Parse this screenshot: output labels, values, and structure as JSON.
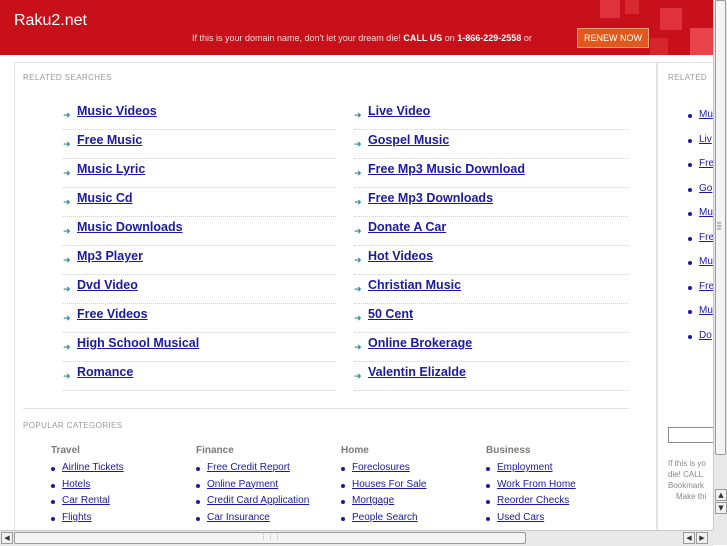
{
  "header": {
    "site_title": "Raku2.net",
    "tagline_prefix": "If this is your domain name, don't let your dream die!",
    "call_us": "CALL US",
    "on": "on",
    "phone": "1-866-229-2558",
    "or": "or",
    "renew_label": "RENEW NOW",
    "bg_color": "#c8101a"
  },
  "related_searches": {
    "label": "RELATED SEARCHES",
    "left": [
      "Music Videos",
      "Free Music",
      "Music Lyric",
      "Music Cd",
      "Music Downloads",
      "Mp3 Player",
      "Dvd Video",
      "Free Videos",
      "High School Musical",
      "Romance"
    ],
    "right": [
      "Live Video",
      "Gospel Music",
      "Free Mp3 Music Download",
      "Free Mp3 Downloads",
      "Donate A Car",
      "Hot Videos",
      "Christian Music",
      "50 Cent",
      "Online Brokerage",
      "Valentin Elizalde"
    ]
  },
  "popular_categories": {
    "label": "POPULAR CATEGORIES",
    "columns": [
      {
        "title": "Travel",
        "links": [
          "Airline Tickets",
          "Hotels",
          "Car Rental",
          "Flights"
        ]
      },
      {
        "title": "Finance",
        "links": [
          "Free Credit Report",
          "Online Payment",
          "Credit Card Application",
          "Car Insurance"
        ]
      },
      {
        "title": "Home",
        "links": [
          "Foreclosures",
          "Houses For Sale",
          "Mortgage",
          "People Search"
        ]
      },
      {
        "title": "Business",
        "links": [
          "Employment",
          "Work From Home",
          "Reorder Checks",
          "Used Cars"
        ]
      }
    ]
  },
  "sidebar": {
    "label": "RELATED",
    "links": [
      "Mu",
      "Liv",
      "Fre",
      "Go",
      "Mu",
      "Fre",
      "Mu",
      "Fre",
      "Mu",
      "Do"
    ],
    "note_lines": [
      "If this is yo",
      "die! CALL",
      "Bookmark",
      "Make thi"
    ]
  },
  "scrollbars": {
    "vertical_icon": "scrollbar-vertical",
    "horizontal_icon": "scrollbar-horizontal"
  }
}
